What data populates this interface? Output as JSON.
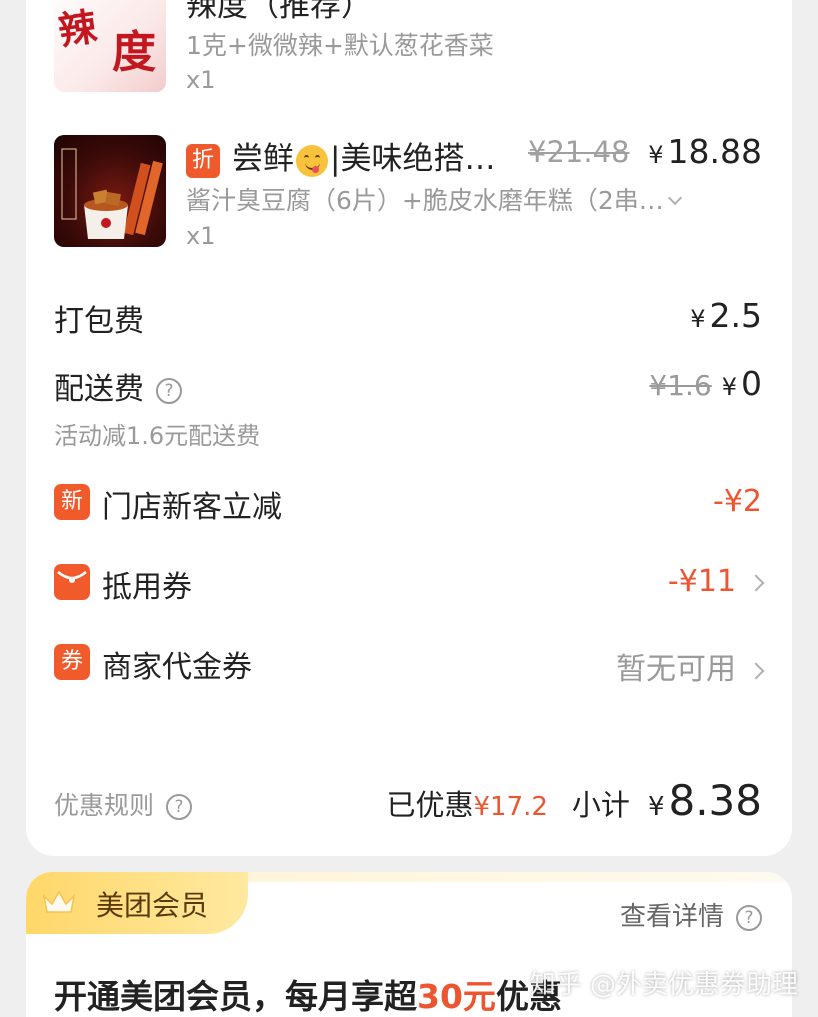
{
  "items": [
    {
      "name": "辣度（推荐）",
      "spec": "1克+微微辣+默认葱花香菜",
      "qty": "x1",
      "thumb_chars": [
        "辣",
        "度"
      ]
    },
    {
      "discount_badge": "折",
      "name_prefix": "尝鲜",
      "emoji": "yum-face-emoji",
      "name_suffix": "|美味绝搭…",
      "original_price": "¥21.48",
      "price_currency": "¥",
      "price_value": "18.88",
      "spec": "酱汁臭豆腐（6片）+脆皮水磨年糕（2串…",
      "qty": "x1"
    }
  ],
  "fees": {
    "packing_label": "打包费",
    "packing_currency": "¥",
    "packing_value": "2.5",
    "delivery_label": "配送费",
    "delivery_original": "¥1.6",
    "delivery_currency": "¥",
    "delivery_value": "0",
    "delivery_note": "活动减1.6元配送费"
  },
  "discounts": [
    {
      "icon_text": "新",
      "label": "门店新客立减",
      "value": "-¥2"
    },
    {
      "icon": "red-envelope-icon",
      "label": "抵用券",
      "value": "-¥11"
    },
    {
      "icon_text": "券",
      "label": "商家代金券",
      "value": "暂无可用"
    }
  ],
  "summary": {
    "rules_label": "优惠规则",
    "saved_label": "已优惠",
    "saved_value": "¥17.2",
    "subtotal_label": "小计",
    "subtotal_currency": "¥",
    "subtotal_value": "8.38"
  },
  "member": {
    "title": "美团会员",
    "detail": "查看详情",
    "promo_prefix": "开通美团会员，每月享超",
    "promo_highlight": "30元",
    "promo_suffix": "优惠"
  },
  "watermark": "知乎 @外卖优惠券助理",
  "colors": {
    "accent": "#ec5530",
    "badge": "#f15b2b",
    "member_gold": "#ffd76a"
  }
}
